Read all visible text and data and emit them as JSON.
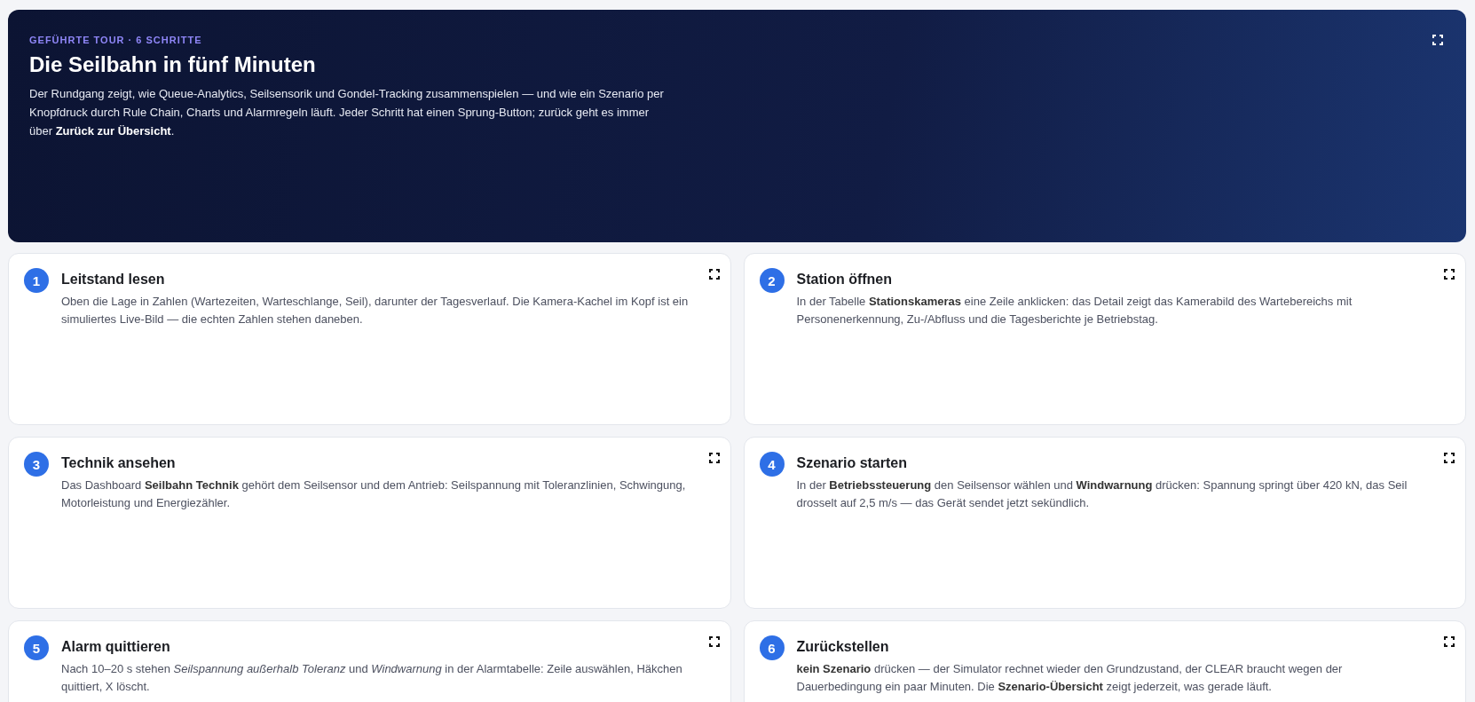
{
  "hero": {
    "eyebrow": "GEFÜHRTE TOUR · 6 SCHRITTE",
    "title": "Die Seilbahn in fünf Minuten",
    "description": "Der Rundgang zeigt, wie Queue-Analytics, Seilsensorik und Gondel-Tracking zusammenspielen — und wie ein Szenario per Knopfdruck durch Rule Chain, Charts und Alarmregeln läuft. Jeder Schritt hat einen Sprung-Button; zurück geht es immer über **Zurück zur Übersicht**."
  },
  "steps": [
    {
      "number": "1",
      "title": "Leitstand lesen",
      "text": "Oben die Lage in Zahlen (Wartezeiten, Warteschlange, Seil), darunter der Tagesverlauf. Die Kamera-Kachel im Kopf ist ein simuliertes Live-Bild — die echten Zahlen stehen daneben."
    },
    {
      "number": "2",
      "title": "Station öffnen",
      "text": "In der Tabelle **Stationskameras** eine Zeile anklicken: das Detail zeigt das Kamerabild des Wartebereichs mit Personenerkennung, Zu-/Abfluss und die Tagesberichte je Betriebstag."
    },
    {
      "number": "3",
      "title": "Technik ansehen",
      "text": "Das Dashboard **Seilbahn Technik** gehört dem Seilsensor und dem Antrieb: Seilspannung mit Toleranzlinien, Schwingung, Motorleistung und Energiezähler."
    },
    {
      "number": "4",
      "title": "Szenario starten",
      "text": "In der **Betriebssteuerung** den Seilsensor wählen und **Windwarnung** drücken: Spannung springt über 420 kN, das Seil drosselt auf 2,5 m/s — das Gerät sendet jetzt sekündlich."
    },
    {
      "number": "5",
      "title": "Alarm quittieren",
      "text": "Nach 10–20 s stehen *Seilspannung außerhalb Toleranz* und *Windwarnung* in der Alarmtabelle: Zeile auswählen, Häkchen quittiert, X löscht."
    },
    {
      "number": "6",
      "title": "Zurückstellen",
      "text": "**kein Szenario** drücken — der Simulator rechnet wieder den Grundzustand, der CLEAR braucht wegen der Dauerbedingung ein paar Minuten. Die **Szenario-Übersicht** zeigt jederzeit, was gerade läuft."
    }
  ]
}
